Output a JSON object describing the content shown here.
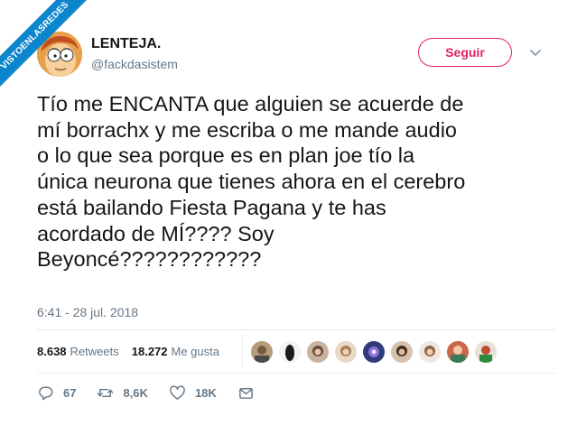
{
  "watermark": {
    "text": "VISTOENLASREDES"
  },
  "user": {
    "name": "LENTEJA.",
    "handle": "@fackdasistem",
    "avatar_icon": "cartoon-fry-avatar"
  },
  "follow_button": {
    "label": "Seguir",
    "color": "#e0245e"
  },
  "tweet": {
    "text": "Tío me ENCANTA que alguien se acuerde de\nmí borrachx y me escriba o me mande audio\no lo que sea porque es en plan joe tío la\núnica neurona que tienes ahora en el cerebro\nestá bailando Fiesta Pagana y te has\nacordado de MÍ???? Soy\nBeyoncé????????????",
    "timestamp": "6:41 - 28 jul. 2018"
  },
  "stats": {
    "retweets_count": "8.638",
    "retweets_label": "Retweets",
    "likes_count": "18.272",
    "likes_label": "Me gusta"
  },
  "actions": {
    "reply_count": "67",
    "retweet_count": "8,6K",
    "like_count": "18K"
  },
  "colors": {
    "text": "#14171a",
    "secondary": "#657786",
    "accent": "#e0245e",
    "watermark": "#0b86cc"
  }
}
